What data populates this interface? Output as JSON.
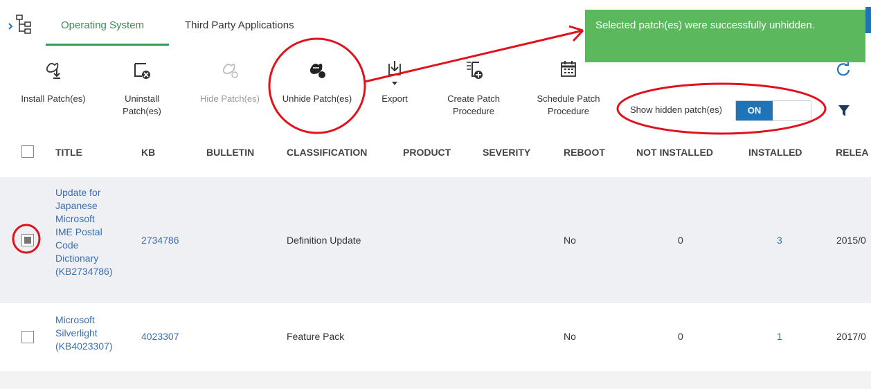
{
  "tabs": [
    {
      "label": "Operating System",
      "active": true
    },
    {
      "label": "Third Party Applications",
      "active": false
    }
  ],
  "toolbar": {
    "install": "Install Patch(es)",
    "uninstall_line1": "Uninstall",
    "uninstall_line2": "Patch(es)",
    "hide": "Hide Patch(es)",
    "unhide": "Unhide Patch(es)",
    "export": "Export",
    "create_line1": "Create Patch",
    "create_line2": "Procedure",
    "schedule_line1": "Schedule Patch",
    "schedule_line2": "Procedure"
  },
  "toggle": {
    "label": "Show hidden patch(es)",
    "state": "ON"
  },
  "toast": {
    "message": "Selected patch(es) were successfully unhidden."
  },
  "table": {
    "columns": [
      "TITLE",
      "KB",
      "BULLETIN",
      "CLASSIFICATION",
      "PRODUCT",
      "SEVERITY",
      "REBOOT",
      "NOT INSTALLED",
      "INSTALLED",
      "RELEA"
    ],
    "rows": [
      {
        "title_lines": [
          "Update for",
          "Japanese",
          "Microsoft",
          "IME Postal",
          "Code",
          "Dictionary",
          "(KB2734786)"
        ],
        "kb": "2734786",
        "classification": "Definition Update",
        "reboot": "No",
        "not_installed": "0",
        "installed": "3",
        "release": "2015/0",
        "checked": true
      },
      {
        "title_lines": [
          "Microsoft",
          "Silverlight",
          "(KB4023307)"
        ],
        "kb": "4023307",
        "classification": "Feature Pack",
        "reboot": "No",
        "not_installed": "0",
        "installed": "1",
        "release": "2017/0",
        "checked": false
      }
    ]
  },
  "colors": {
    "accent": "#2e9d58",
    "toggle_on": "#1f73b7",
    "toast": "#5cb85c",
    "annotation": "#e0121c",
    "link": "#3a6fb0"
  },
  "icons": [
    "tree-icon",
    "install-patch-icon",
    "uninstall-patch-icon",
    "hide-patch-icon",
    "unhide-patch-icon",
    "export-icon",
    "create-procedure-icon",
    "schedule-procedure-icon",
    "refresh-icon",
    "filter-icon"
  ]
}
